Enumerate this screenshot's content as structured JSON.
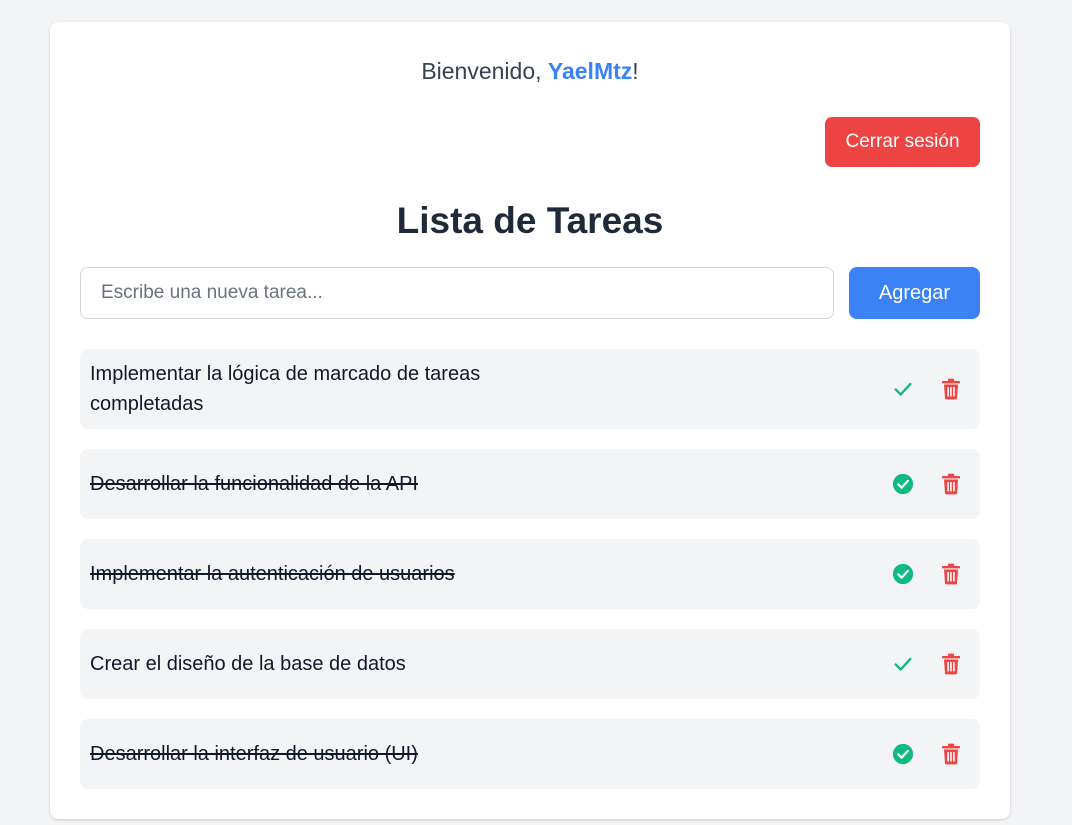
{
  "header": {
    "welcome_prefix": "Bienvenido, ",
    "username": "YaelMtz",
    "welcome_suffix": "!",
    "logout_label": "Cerrar sesión"
  },
  "title": "Lista de Tareas",
  "new_task": {
    "placeholder": "Escribe una nueva tarea...",
    "value": "",
    "add_label": "Agregar"
  },
  "tasks": [
    {
      "text": "Implementar la lógica de marcado de tareas completadas",
      "completed": false,
      "check_icon": "check-icon",
      "delete_icon": "trash-icon"
    },
    {
      "text": "Desarrollar la funcionalidad de la API",
      "completed": true,
      "check_icon": "check-circle-icon",
      "delete_icon": "trash-icon"
    },
    {
      "text": "Implementar la autenticación de usuarios",
      "completed": true,
      "check_icon": "check-circle-icon",
      "delete_icon": "trash-icon"
    },
    {
      "text": "Crear el diseño de la base de datos",
      "completed": false,
      "check_icon": "check-icon",
      "delete_icon": "trash-icon"
    },
    {
      "text": "Desarrollar la interfaz de usuario (UI)",
      "completed": true,
      "check_icon": "check-circle-icon",
      "delete_icon": "trash-icon"
    }
  ],
  "colors": {
    "accent": "#3b82f6",
    "danger": "#ef4444",
    "success": "#10b981",
    "background": "#f3f4f6"
  }
}
